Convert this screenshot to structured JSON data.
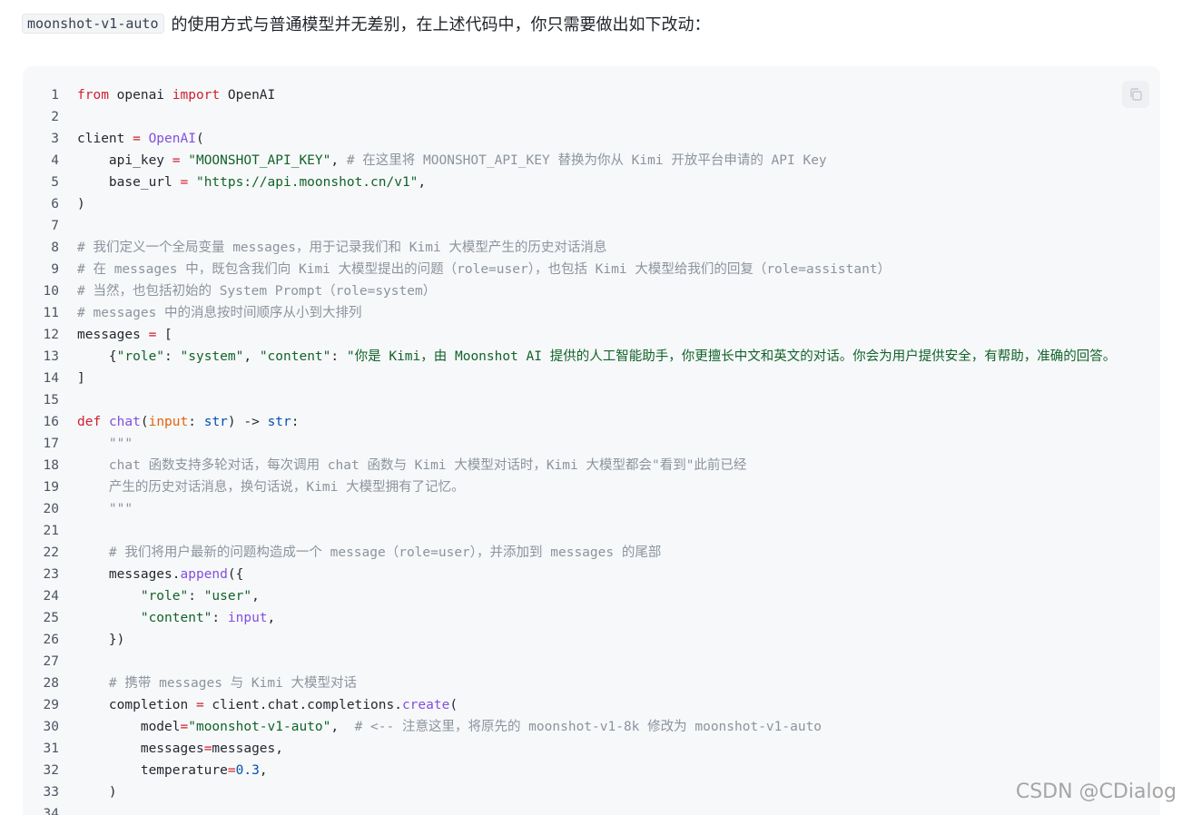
{
  "intro": {
    "inline_code": "moonshot-v1-auto",
    "text": "的使用方式与普通模型并无差别，在上述代码中，你只需要做出如下改动："
  },
  "copy_button": {
    "icon": "copy-icon"
  },
  "code_lines": [
    {
      "n": "1",
      "tokens": [
        {
          "t": "from",
          "c": "kw"
        },
        {
          "t": " openai "
        },
        {
          "t": "import",
          "c": "kw"
        },
        {
          "t": " OpenAI"
        }
      ]
    },
    {
      "n": "2",
      "tokens": []
    },
    {
      "n": "3",
      "tokens": [
        {
          "t": "client "
        },
        {
          "t": "=",
          "c": "kw"
        },
        {
          "t": " "
        },
        {
          "t": "OpenAI",
          "c": "fn"
        },
        {
          "t": "("
        }
      ]
    },
    {
      "n": "4",
      "tokens": [
        {
          "t": "    api_key "
        },
        {
          "t": "=",
          "c": "kw"
        },
        {
          "t": " "
        },
        {
          "t": "\"MOONSHOT_API_KEY\"",
          "c": "str"
        },
        {
          "t": ", "
        },
        {
          "t": "# 在这里将 MOONSHOT_API_KEY 替换为你从 Kimi 开放平台申请的 API Key",
          "c": "com"
        }
      ]
    },
    {
      "n": "5",
      "tokens": [
        {
          "t": "    base_url "
        },
        {
          "t": "=",
          "c": "kw"
        },
        {
          "t": " "
        },
        {
          "t": "\"https://api.moonshot.cn/v1\"",
          "c": "str"
        },
        {
          "t": ","
        }
      ]
    },
    {
      "n": "6",
      "tokens": [
        {
          "t": ")"
        }
      ]
    },
    {
      "n": "7",
      "tokens": []
    },
    {
      "n": "8",
      "tokens": [
        {
          "t": "# 我们定义一个全局变量 messages，用于记录我们和 Kimi 大模型产生的历史对话消息",
          "c": "com"
        }
      ]
    },
    {
      "n": "9",
      "tokens": [
        {
          "t": "# 在 messages 中，既包含我们向 Kimi 大模型提出的问题（role=user），也包括 Kimi 大模型给我们的回复（role=assistant）",
          "c": "com"
        }
      ]
    },
    {
      "n": "10",
      "tokens": [
        {
          "t": "# 当然，也包括初始的 System Prompt（role=system）",
          "c": "com"
        }
      ]
    },
    {
      "n": "11",
      "tokens": [
        {
          "t": "# messages 中的消息按时间顺序从小到大排列",
          "c": "com"
        }
      ]
    },
    {
      "n": "12",
      "tokens": [
        {
          "t": "messages "
        },
        {
          "t": "=",
          "c": "kw"
        },
        {
          "t": " ["
        }
      ]
    },
    {
      "n": "13",
      "tokens": [
        {
          "t": "    {"
        },
        {
          "t": "\"role\"",
          "c": "str"
        },
        {
          "t": ": "
        },
        {
          "t": "\"system\"",
          "c": "str"
        },
        {
          "t": ", "
        },
        {
          "t": "\"content\"",
          "c": "str"
        },
        {
          "t": ": "
        },
        {
          "t": "\"你是 Kimi，由 Moonshot AI 提供的人工智能助手，你更擅长中文和英文的对话。你会为用户提供安全，有帮助，准确的回答。",
          "c": "str"
        }
      ]
    },
    {
      "n": "14",
      "tokens": [
        {
          "t": "]"
        }
      ]
    },
    {
      "n": "15",
      "tokens": []
    },
    {
      "n": "16",
      "tokens": [
        {
          "t": "def",
          "c": "kw"
        },
        {
          "t": " "
        },
        {
          "t": "chat",
          "c": "fn"
        },
        {
          "t": "("
        },
        {
          "t": "input",
          "c": "param"
        },
        {
          "t": ": "
        },
        {
          "t": "str",
          "c": "bi"
        },
        {
          "t": ") -> "
        },
        {
          "t": "str",
          "c": "bi"
        },
        {
          "t": ":"
        }
      ]
    },
    {
      "n": "17",
      "tokens": [
        {
          "t": "    \"\"\"",
          "c": "com"
        }
      ]
    },
    {
      "n": "18",
      "tokens": [
        {
          "t": "    chat 函数支持多轮对话，每次调用 chat 函数与 Kimi 大模型对话时，Kimi 大模型都会\"看到\"此前已经",
          "c": "com"
        }
      ]
    },
    {
      "n": "19",
      "tokens": [
        {
          "t": "    产生的历史对话消息，换句话说，Kimi 大模型拥有了记忆。",
          "c": "com"
        }
      ]
    },
    {
      "n": "20",
      "tokens": [
        {
          "t": "    \"\"\"",
          "c": "com"
        }
      ]
    },
    {
      "n": "21",
      "tokens": []
    },
    {
      "n": "22",
      "tokens": [
        {
          "t": "    # 我们将用户最新的问题构造成一个 message（role=user），并添加到 messages 的尾部",
          "c": "com"
        }
      ]
    },
    {
      "n": "23",
      "tokens": [
        {
          "t": "    messages."
        },
        {
          "t": "append",
          "c": "fn"
        },
        {
          "t": "({"
        }
      ]
    },
    {
      "n": "24",
      "tokens": [
        {
          "t": "        "
        },
        {
          "t": "\"role\"",
          "c": "str"
        },
        {
          "t": ": "
        },
        {
          "t": "\"user\"",
          "c": "str"
        },
        {
          "t": ","
        }
      ]
    },
    {
      "n": "25",
      "tokens": [
        {
          "t": "        "
        },
        {
          "t": "\"content\"",
          "c": "str"
        },
        {
          "t": ": "
        },
        {
          "t": "input",
          "c": "fn"
        },
        {
          "t": ","
        }
      ]
    },
    {
      "n": "26",
      "tokens": [
        {
          "t": "    })"
        }
      ]
    },
    {
      "n": "27",
      "tokens": []
    },
    {
      "n": "28",
      "tokens": [
        {
          "t": "    # 携带 messages 与 Kimi 大模型对话",
          "c": "com"
        }
      ]
    },
    {
      "n": "29",
      "tokens": [
        {
          "t": "    completion "
        },
        {
          "t": "=",
          "c": "kw"
        },
        {
          "t": " client.chat.completions."
        },
        {
          "t": "create",
          "c": "fn"
        },
        {
          "t": "("
        }
      ]
    },
    {
      "n": "30",
      "tokens": [
        {
          "t": "        model"
        },
        {
          "t": "=",
          "c": "kw"
        },
        {
          "t": "\"moonshot-v1-auto\"",
          "c": "str"
        },
        {
          "t": ",  "
        },
        {
          "t": "# <-- 注意这里，将原先的 moonshot-v1-8k 修改为 moonshot-v1-auto",
          "c": "com"
        }
      ]
    },
    {
      "n": "31",
      "tokens": [
        {
          "t": "        messages"
        },
        {
          "t": "=",
          "c": "kw"
        },
        {
          "t": "messages,"
        }
      ]
    },
    {
      "n": "32",
      "tokens": [
        {
          "t": "        temperature"
        },
        {
          "t": "=",
          "c": "kw"
        },
        {
          "t": "0.3",
          "c": "num"
        },
        {
          "t": ","
        }
      ]
    },
    {
      "n": "33",
      "tokens": [
        {
          "t": "    )"
        }
      ]
    },
    {
      "n": "34",
      "tokens": []
    }
  ],
  "watermark": "CSDN @CDialog"
}
